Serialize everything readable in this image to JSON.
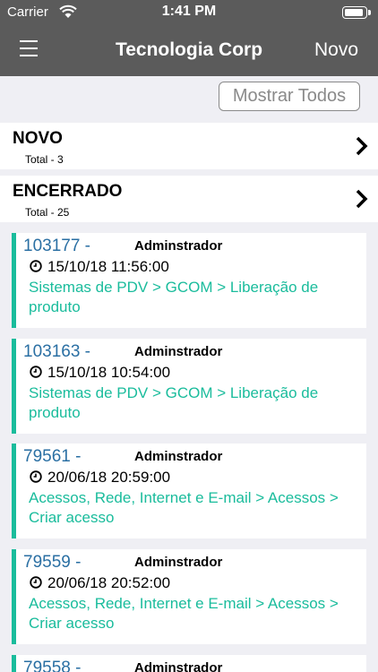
{
  "status_bar": {
    "carrier": "Carrier",
    "time": "1:41 PM"
  },
  "nav": {
    "title": "Tecnologia Corp",
    "new_label": "Novo",
    "menu_icon": "hamburger-menu-icon"
  },
  "show_all_label": "Mostrar Todos",
  "categories": [
    {
      "name": "NOVO",
      "total": "Total - 3"
    },
    {
      "name": "ENCERRADO",
      "total": "Total - 25"
    }
  ],
  "tickets": [
    {
      "number": "103177 -",
      "user": "Adminstrador",
      "date": "15/10/18 11:56:00",
      "description": "Sistemas de PDV > GCOM > Liberação de produto"
    },
    {
      "number": "103163 -",
      "user": "Adminstrador",
      "date": "15/10/18 10:54:00",
      "description": "Sistemas de PDV > GCOM > Liberação de produto"
    },
    {
      "number": "79561 -",
      "user": "Adminstrador",
      "date": "20/06/18 20:59:00",
      "description": "Acessos, Rede, Internet e E-mail > Acessos > Criar acesso"
    },
    {
      "number": "79559 -",
      "user": "Adminstrador",
      "date": "20/06/18 20:52:00",
      "description": "Acessos, Rede, Internet e E-mail > Acessos > Criar acesso"
    },
    {
      "number": "79558 -",
      "user": "Adminstrador",
      "date": "",
      "description": ""
    }
  ],
  "colors": {
    "bar": "#5b5b5b",
    "accent": "#1abc9c",
    "link": "#2a6fa3",
    "background": "#efeff4"
  }
}
